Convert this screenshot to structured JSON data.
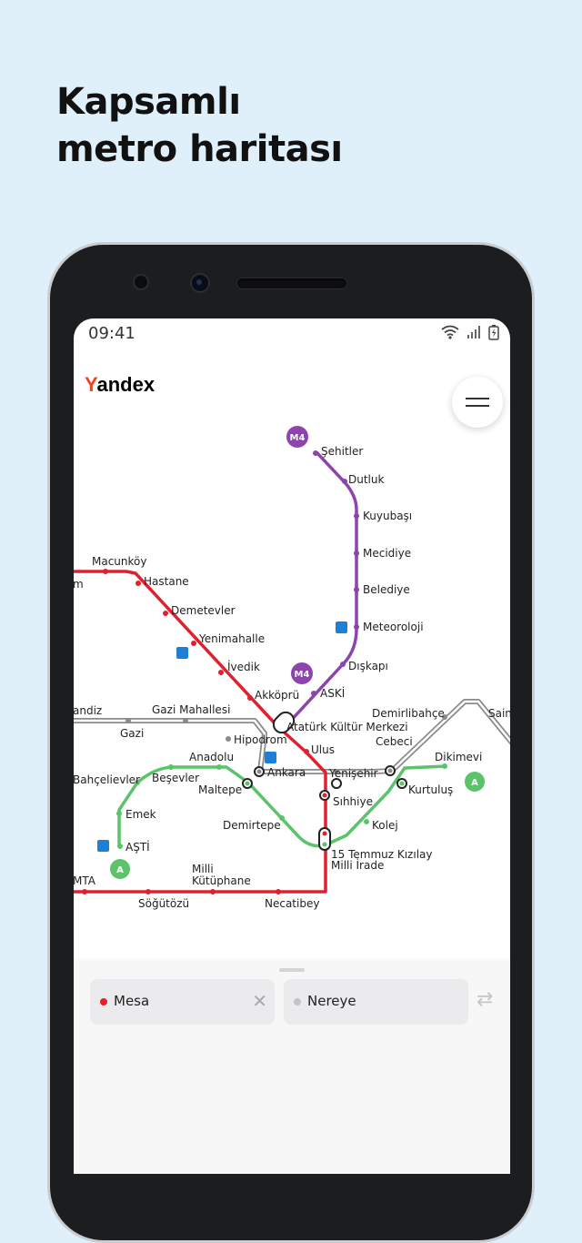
{
  "headline": {
    "line1": "Kapsamlı",
    "line2": "metro haritası"
  },
  "status_bar": {
    "time": "09:41"
  },
  "app": {
    "logo_first": "Y",
    "logo_rest": "andex"
  },
  "map": {
    "colors": {
      "red": "#e0202f",
      "purple": "#8e44ad",
      "green": "#5bc36a",
      "gray": "#8a8a8a"
    },
    "line_badges": {
      "m4_top": "M4",
      "m4_mid": "M4",
      "a_left": "A",
      "a_right": "A"
    },
    "stations": {
      "sehitler": "Şehitler",
      "dutluk": "Dutluk",
      "kuyubasi": "Kuyubaşı",
      "mecidiye": "Mecidiye",
      "belediye": "Belediye",
      "meteoroloji": "Meteoroloji",
      "diskapi": "Dışkapı",
      "aski": "ASKİ",
      "ataturk_kultur": "Atatürk Kültür Merkezi",
      "macunkoy": "Macunköy",
      "hastane": "Hastane",
      "demetevler": "Demetevler",
      "yenimahalle": "Yenimahalle",
      "ivedik": "İvedik",
      "akkopru": "Akköprü",
      "ulus": "Ulus",
      "sihhiye": "Sıhhiye",
      "kizilay": "15 Temmuz Kızılay",
      "milli_irade": "Milli İrade",
      "necatibey": "Necatibey",
      "milli_kutuphane_1": "Milli",
      "milli_kutuphane_2": "Kütüphane",
      "sogutozu": "Söğütözü",
      "mta": "MTA",
      "m_partial": "m",
      "bandiz": "andiz",
      "gazi": "Gazi",
      "gazi_mahallesi": "Gazi Mahallesi",
      "hipodrom": "Hipodrom",
      "ankara": "Ankara",
      "yenisehir": "Yenişehir",
      "cebeci": "Cebeci",
      "demirlibahce": "Demirlibahçe",
      "saimekadin": "Sain",
      "dikimevi": "Dikimevi",
      "kurtulus": "Kurtuluş",
      "kolej": "Kolej",
      "demirtepe": "Demirtepe",
      "maltepe": "Maltepe",
      "anadolu": "Anadolu",
      "besevler": "Beşevler",
      "bahcelievler": "Bahçelievler",
      "emek": "Emek",
      "asti": "AŞTİ"
    }
  },
  "route_panel": {
    "from_value": "Mesa",
    "to_placeholder": "Nereye",
    "from_dot_color": "#e0202f",
    "to_dot_color": "#c4c4c6"
  }
}
